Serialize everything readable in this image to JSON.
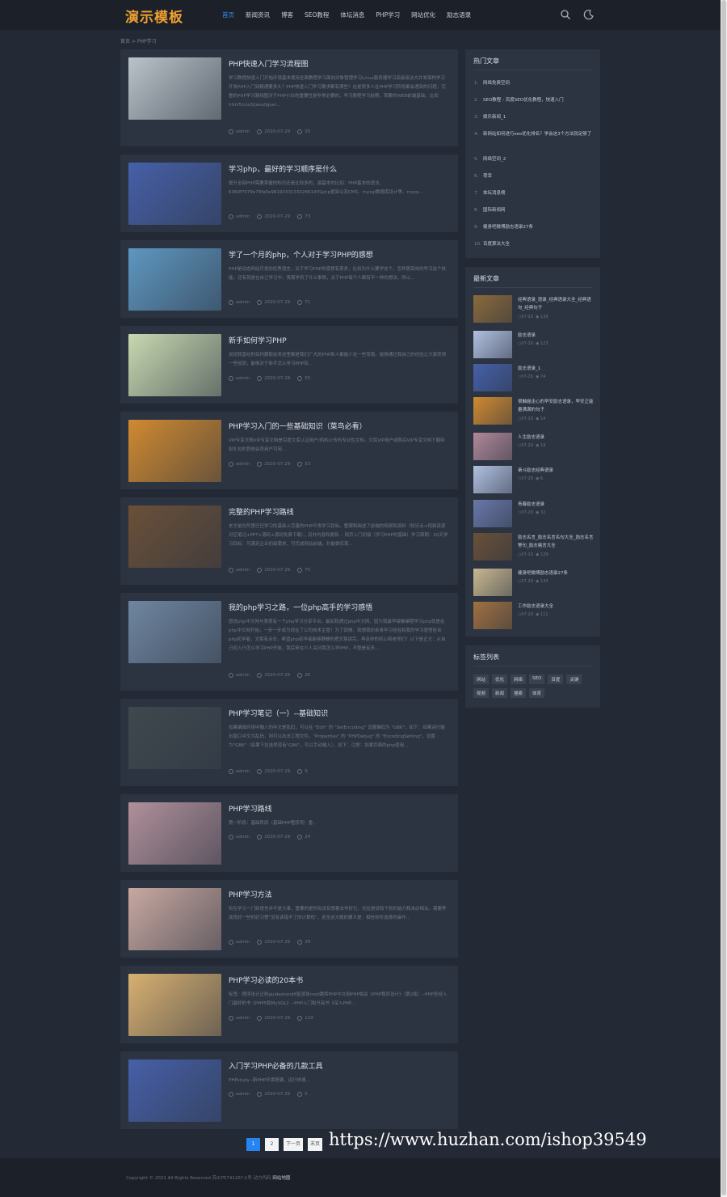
{
  "header": {
    "logo": "演示模板",
    "nav": [
      "首页",
      "新闻资讯",
      "博客",
      "SEO教程",
      "体坛消息",
      "PHP学习",
      "网站优化",
      "励志语录"
    ],
    "active_index": 0,
    "icons": [
      "search-icon",
      "moon-icon"
    ]
  },
  "breadcrumb": "首页 > PHP学习",
  "posts": [
    {
      "title": "PHP快速入门学习流程图",
      "desc": "学习教程快速入门开始环境基本使用全面教程学习面向对象管理学习Linux服务器学习高级用法大并发架构学习开发PHP入门到精通要多久？PHP快速入门学习要求都有哪些？这是很多人在PHP学习阶段都会遇到的问题，完整的PHP学习路线图对于PHP小白的重要性是非常必要的。学习教程学习前期，首要的WEB前端基础，比如html5/css3/java/jquer...",
      "author": "admin",
      "date": "2020-07-29",
      "views": "35",
      "thumb": "#b9c3c8"
    },
    {
      "title": "学习php，最好的学习顺序是什么",
      "desc": "提升全部PHP需要掌握的知识还是比较多的，最基本的比如：PHP基本的语法、6360f7079e79fa5e98193331333266143Sphp框架以及CMS、mysql数据库设计等、mysq...",
      "author": "admin",
      "date": "2020-07-29",
      "views": "73",
      "thumb": "#4660a8"
    },
    {
      "title": "学了一个月的php，个人对于学习PHP的感想",
      "desc": "PHP是动态网站开发的优秀语言，关于学习PHP的感想有很多，比如为什么要学这个，怎样更高效的学习这个技能，还有就是在自己学习中，我需学到了什么事情，关于PHP每个人都有不一样的想法，所以...",
      "author": "admin",
      "date": "2020-07-29",
      "views": "71",
      "thumb": "#5e97c0"
    },
    {
      "title": "新手如何学习PHP",
      "desc": "说说我曾经的如何跟那前来这里都是我们广大的PHP新人都能少走一些弯路，能够通过我自己的经验让大家获得一些收获，能够对于新手怎么学习PHP有...",
      "author": "admin",
      "date": "2020-07-29",
      "views": "55",
      "thumb": "#c8d8b0"
    },
    {
      "title": "PHP学习入门的一些基础知识（菜鸟必看）",
      "desc": "VIP专享文档VIP专享文档是百度文库认证用户/机构上传的专业性文档，文库VIP用户或购买VIP专享文档下载特权礼包的其他会员用户可用...",
      "author": "admin",
      "date": "2020-07-29",
      "views": "53",
      "thumb": "#d08a30"
    },
    {
      "title": "完整的PHP学习路线",
      "desc": "本文是在阿里巴巴学习的基础上完善的PHP开发学习目标。整理和阐述了前端的视频和资料（知识点+视频资源对应笔记+PPT+源码+源码免费下载），另外内容和更新... 网页入门初级（学习PHP的基础）学习周期：20天学习目标：可满足企业初级需求，可完成网站前端，并能做实现...",
      "author": "admin",
      "date": "2020-07-29",
      "views": "75",
      "thumb": "#6a5038"
    },
    {
      "title": "我的php学习之路，一位php高手的学习感悟",
      "desc": "感觉php中文网与我很有一个php学习分享平台，最如我通过php中文网，因为我最早接触编程学习php就是在php中文网开始，一步一步成为现在了公司技术主管！为了回馈，我想我的亲身学习经验和我的学习感悟告诉php初学者，文章有点长，希望php初学者能够静静的把文章读完，再走你的初心和老师们！以下是正文：从自己初入行怎么学习PHP开始，我后来在少人关问我怎么学PHP，不管是有多...",
      "author": "admin",
      "date": "2020-07-29",
      "views": "26",
      "thumb": "#6f86a0"
    },
    {
      "title": "PHP学习笔记（一）--基础知识",
      "desc": "如果编辑环境中输入的中文是乱码，可以在 \"Edit\" 的 \"SetEncoding\" 设置编码为 \"GBK\"，如下：如果运行输出窗口中文为乱码，则可以右击工程文件，\"Properties\" 的 \"PHPDebug\" 的 \"EncodingSetting\"，设置为\"GBK\"（如果下拉选项没有\"GBK\"，可以手动输入），如下：注意：如果页面的php使用...",
      "author": "admin",
      "date": "2020-07-29",
      "views": "9",
      "thumb": "#40484e"
    },
    {
      "title": "PHP学习路线",
      "desc": "第一阶段：基础阶段（基础PHP程序员）重...",
      "author": "admin",
      "date": "2020-07-29",
      "views": "24",
      "thumb": "#b0909a"
    },
    {
      "title": "PHP学习方法",
      "desc": "实在学习一门新语言并不是大事，重要的是你有没有想着去学好它。光拉是说和个别的能力和未必相关。需要养成良好一些的好习惯\"没有读错不了的计算机\"，说全这大概的要义是：相信你所选择的操作...",
      "author": "admin",
      "date": "2020-07-29",
      "views": "39",
      "thumb": "#c8a8a0"
    },
    {
      "title": "PHP学习必读的20本书",
      "desc": "标签：程序设计正则guidextendif富源驾mod跳转PHP中文网PHP相关《PHP程序设计》（第2版）--PHP圣经入门最好的书《PHP5和MySQL》--PHP入门和升高书《深入PHP...",
      "author": "admin",
      "date": "2020-07-29",
      "views": "119",
      "thumb": "#d8b070"
    },
    {
      "title": "入门学习PHP必备的几款工具",
      "desc": "PHPstudy--新PHP环境搭建，运行快速...",
      "author": "admin",
      "date": "2020-07-29",
      "views": "5",
      "thumb": "#4660a8"
    }
  ],
  "hot": {
    "title": "热门文章",
    "items": [
      "网络免费空间",
      "SEO教程 - 百度SEO优化教程，快速入门",
      "娱乐新闻_1",
      "新网站如何进行seo优化排名？学会这3个方法就足够了",
      "网络空间_2",
      "荷幸",
      "体坛消息榜",
      "国际新闻网",
      "健身吧微博励志语录27条",
      "百度算法大全"
    ]
  },
  "latest": {
    "title": "最新文章",
    "items": [
      {
        "title": "经典语录_语录_经典语录大全_经典语句_经典句子",
        "date": "07-29",
        "views": "139",
        "color": "#8a6a3a"
      },
      {
        "title": "励志语录",
        "date": "07-29",
        "views": "123",
        "color": "#b0c0e0"
      },
      {
        "title": "励志语录_1",
        "date": "07-29",
        "views": "74",
        "color": "#4660a8"
      },
      {
        "title": "很触碰走心的早安励志语录，早安正能量满满的句子",
        "date": "07-29",
        "views": "14",
        "color": "#d08a30"
      },
      {
        "title": "人生励志语录",
        "date": "07-29",
        "views": "19",
        "color": "#b08898"
      },
      {
        "title": "奋斗励志经典语录",
        "date": "07-29",
        "views": "6",
        "color": "#b0c0e0"
      },
      {
        "title": "青春励志语录",
        "date": "07-29",
        "views": "32",
        "color": "#6878a8"
      },
      {
        "title": "励志名言_励志名言名句大全_励志名言警句_励志格言大全",
        "date": "07-29",
        "views": "129",
        "color": "#6a5038"
      },
      {
        "title": "健身吧微博励志语录27条",
        "date": "07-29",
        "views": "143",
        "color": "#c8b890"
      },
      {
        "title": "工作励志语录大全",
        "date": "07-29",
        "views": "111",
        "color": "#a07040"
      }
    ]
  },
  "tags": {
    "title": "标签列表",
    "items": [
      "网站",
      "优化",
      "网络",
      "SEO",
      "百度",
      "关键",
      "视频",
      "新闻",
      "搜索",
      "体育"
    ]
  },
  "pagination": {
    "items": [
      "1",
      "2",
      "下一页",
      "末页"
    ],
    "current_index": 0
  },
  "watermark": "https://www.huzhan.com/ishop39549",
  "footer": {
    "text": "Copyright © 2021 All Rights Reserved 苏ICP574126?-1号 动力代码",
    "link": "网站地图"
  },
  "colors": {
    "accent": "#2684f0",
    "logo": "#f0a030",
    "bg": "#232935",
    "card": "#2c3341"
  }
}
